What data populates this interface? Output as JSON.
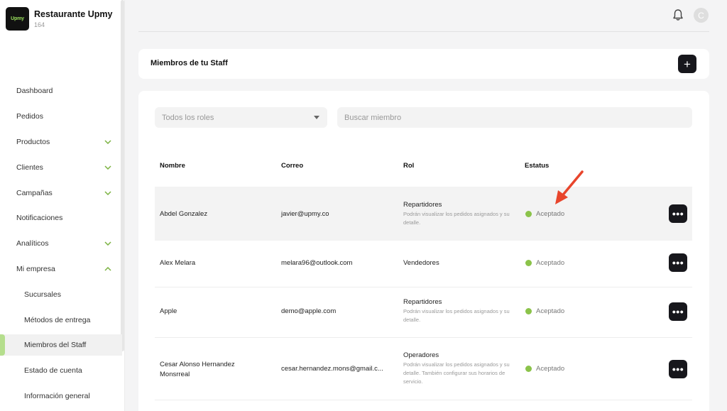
{
  "brand": {
    "logo_text": "Upmy",
    "name": "Restaurante Upmy",
    "sub": "164"
  },
  "sidebar": {
    "items": [
      {
        "label": "Dashboard"
      },
      {
        "label": "Pedidos"
      },
      {
        "label": "Productos"
      },
      {
        "label": "Clientes"
      },
      {
        "label": "Campañas"
      },
      {
        "label": "Notificaciones"
      },
      {
        "label": "Analíticos"
      },
      {
        "label": "Mi empresa"
      },
      {
        "label": "Sucursales"
      },
      {
        "label": "Métodos de entrega"
      },
      {
        "label": "Miembros del Staff"
      },
      {
        "label": "Estado de cuenta"
      },
      {
        "label": "Información general"
      }
    ]
  },
  "topbar": {
    "avatar_initial": "C"
  },
  "header": {
    "title": "Miembros de tu Staff",
    "add_label": "+"
  },
  "filters": {
    "role_select_value": "Todos los roles",
    "search_placeholder": "Buscar miembro"
  },
  "table": {
    "headers": {
      "name": "Nombre",
      "email": "Correo",
      "role": "Rol",
      "status": "Estatus"
    },
    "rows": [
      {
        "name": "Abdel Gonzalez",
        "email": "javier@upmy.co",
        "role": "Repartidores",
        "role_desc": "Podrán visualizar los pedidos asignados y su detalle.",
        "status": "Aceptado"
      },
      {
        "name": "Alex Melara",
        "email": "melara96@outlook.com",
        "role": "Vendedores",
        "role_desc": "",
        "status": "Aceptado"
      },
      {
        "name": "Apple",
        "email": "demo@apple.com",
        "role": "Repartidores",
        "role_desc": "Podrán visualizar los pedidos asignados y su detalle.",
        "status": "Aceptado"
      },
      {
        "name": "Cesar Alonso Hernandez Monsrreal",
        "email": "cesar.hernandez.mons@gmail.c...",
        "role": "Operadores",
        "role_desc": "Podrán visualizar los pedidos asignados y su detalle. También configurar sus horarios de servicio.",
        "status": "Aceptado"
      }
    ],
    "more_label": "•••"
  },
  "colors": {
    "accent": "#b5de8d",
    "status_green": "#8bc34a",
    "dark_button": "#17171c",
    "arrow": "#e8452c"
  }
}
